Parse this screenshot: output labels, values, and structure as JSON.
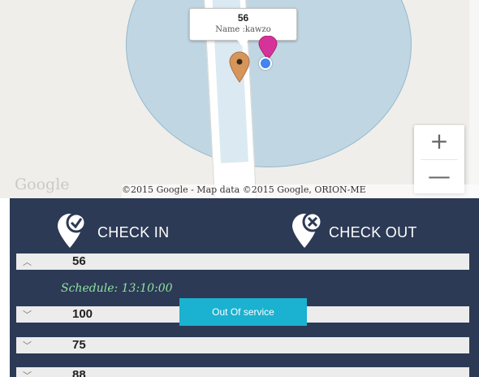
{
  "map": {
    "info_window": {
      "title": "56",
      "subtitle": "Name :kawzo"
    },
    "zoom_in_label": "+",
    "zoom_out_label": "—",
    "google_logo": "Google",
    "attribution": "©2015 Google - Map data ©2015 Google, ORION-ME"
  },
  "actions": {
    "check_in_label": "CHECK IN",
    "check_out_label": "CHECK OUT"
  },
  "rows": [
    {
      "label": "56",
      "chevron": "︿",
      "expanded": true
    },
    {
      "label": "100",
      "chevron": "﹀",
      "expanded": false
    },
    {
      "label": "75",
      "chevron": "﹀",
      "expanded": false
    },
    {
      "label": "88",
      "chevron": "﹀",
      "expanded": false
    }
  ],
  "schedule": "Schedule: 13:10:00",
  "toast": "Out Of service",
  "colors": {
    "panel_bg": "#2c3a55",
    "toast_bg": "#1bb1d0",
    "schedule_text": "#8fe0a0",
    "pin_brown": "#d6955a",
    "pin_pink": "#d6339a"
  }
}
